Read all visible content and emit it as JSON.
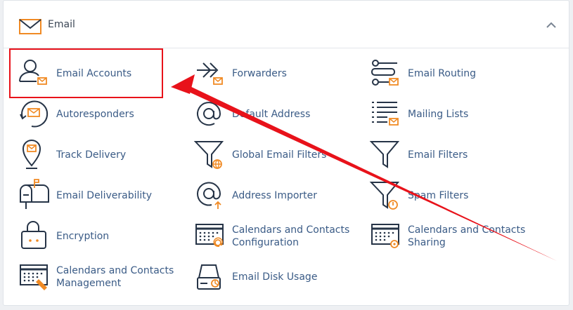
{
  "section": {
    "title": "Email",
    "icon": "envelope-icon",
    "collapse_icon": "chevron-up-icon"
  },
  "items": [
    {
      "label": "Email Accounts",
      "icon": "email-accounts-icon"
    },
    {
      "label": "Forwarders",
      "icon": "forwarders-icon"
    },
    {
      "label": "Email Routing",
      "icon": "email-routing-icon"
    },
    {
      "label": "Autoresponders",
      "icon": "autoresponders-icon"
    },
    {
      "label": "Default Address",
      "icon": "default-address-icon"
    },
    {
      "label": "Mailing Lists",
      "icon": "mailing-lists-icon"
    },
    {
      "label": "Track Delivery",
      "icon": "track-delivery-icon"
    },
    {
      "label": "Global Email Filters",
      "icon": "global-email-filters-icon"
    },
    {
      "label": "Email Filters",
      "icon": "email-filters-icon"
    },
    {
      "label": "Email Deliverability",
      "icon": "email-deliverability-icon"
    },
    {
      "label": "Address Importer",
      "icon": "address-importer-icon"
    },
    {
      "label": "Spam Filters",
      "icon": "spam-filters-icon"
    },
    {
      "label": "Encryption",
      "icon": "encryption-icon"
    },
    {
      "label": "Calendars and Contacts Configuration",
      "icon": "calendar-configuration-icon"
    },
    {
      "label": "Calendars and Contacts Sharing",
      "icon": "calendar-sharing-icon"
    },
    {
      "label": "Calendars and Contacts Management",
      "icon": "calendar-management-icon"
    },
    {
      "label": "Email Disk Usage",
      "icon": "disk-usage-icon"
    }
  ],
  "colors": {
    "accent": "#f08a24",
    "icon_stroke": "#263447",
    "link": "#3a5b86",
    "annotation": "#e8121a"
  }
}
